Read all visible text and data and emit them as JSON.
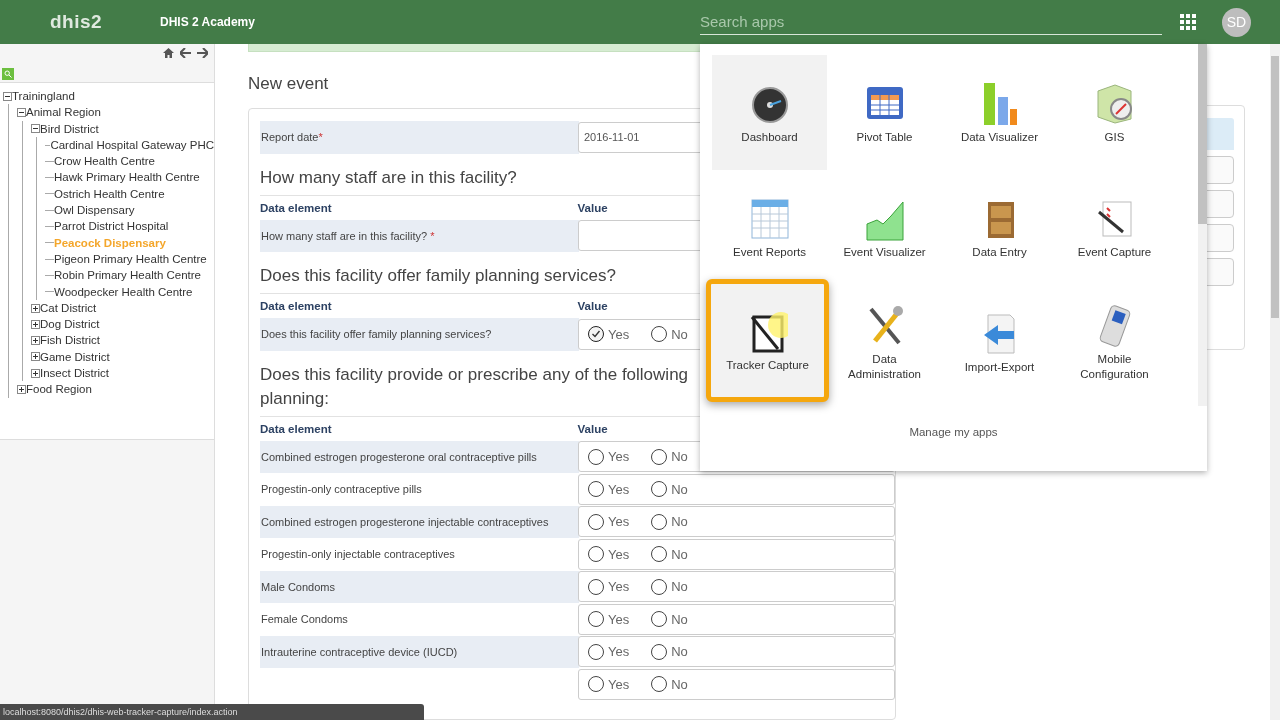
{
  "header": {
    "logo": "dhis2",
    "title": "DHIS 2 Academy",
    "search": {
      "placeholder": "Search apps"
    },
    "avatar": "SD"
  },
  "sidebar": {
    "tree": [
      {
        "label": "Trainingland",
        "expanded": true,
        "selected": false,
        "children": [
          {
            "label": "Animal Region",
            "expanded": true,
            "selected": false,
            "children": [
              {
                "label": "Bird District",
                "expanded": true,
                "selected": false,
                "children": [
                  {
                    "label": "Cardinal Hospital Gateway PHC",
                    "selected": false
                  },
                  {
                    "label": "Crow Health Centre",
                    "selected": false
                  },
                  {
                    "label": "Hawk Primary Health Centre",
                    "selected": false
                  },
                  {
                    "label": "Ostrich Health Centre",
                    "selected": false
                  },
                  {
                    "label": "Owl Dispensary",
                    "selected": false
                  },
                  {
                    "label": "Parrot District Hospital",
                    "selected": false
                  },
                  {
                    "label": "Peacock Dispensary",
                    "selected": true
                  },
                  {
                    "label": "Pigeon Primary Health Centre",
                    "selected": false
                  },
                  {
                    "label": "Robin Primary Health Centre",
                    "selected": false
                  },
                  {
                    "label": "Woodpecker Health Centre",
                    "selected": false
                  }
                ]
              },
              {
                "label": "Cat District",
                "expanded": false,
                "selected": false
              },
              {
                "label": "Dog District",
                "expanded": false,
                "selected": false
              },
              {
                "label": "Fish District",
                "expanded": false,
                "selected": false
              },
              {
                "label": "Game District",
                "expanded": false,
                "selected": false
              },
              {
                "label": "Insect District",
                "expanded": false,
                "selected": false
              }
            ]
          },
          {
            "label": "Food Region",
            "expanded": false,
            "selected": false
          }
        ]
      }
    ]
  },
  "main": {
    "title": "New event",
    "report_date": {
      "label": "Report date",
      "required_mark": "*",
      "value": "2016-11-01"
    },
    "sections": [
      {
        "title_lines": [
          "How many staff are in this facility?"
        ],
        "columns": [
          "Data element",
          "Value"
        ],
        "rows": [
          {
            "kind": "number",
            "label": "How many staff are in this facility?",
            "required_mark": "*"
          }
        ]
      },
      {
        "title_lines": [
          "Does this facility offer family planning services?"
        ],
        "columns": [
          "Data element",
          "Value"
        ],
        "rows": [
          {
            "kind": "yes_no",
            "label": "Does this facility offer family planning services?",
            "options": [
              {
                "label": "Yes",
                "selected": true
              },
              {
                "label": "No",
                "selected": false
              }
            ]
          }
        ]
      },
      {
        "title_lines": [
          "Does this facility provide or prescribe any of the following",
          "planning:"
        ],
        "columns": [
          "Data element",
          "Value"
        ],
        "rows": [
          {
            "kind": "yes_no",
            "label": "Combined estrogen progesterone oral contraceptive pills",
            "options": [
              {
                "label": "Yes",
                "selected": false
              },
              {
                "label": "No",
                "selected": false
              }
            ]
          },
          {
            "kind": "yes_no",
            "label": "Progestin-only contraceptive pills",
            "options": [
              {
                "label": "Yes",
                "selected": false
              },
              {
                "label": "No",
                "selected": false
              }
            ]
          },
          {
            "kind": "yes_no",
            "label": "Combined estrogen progesterone injectable contraceptives",
            "options": [
              {
                "label": "Yes",
                "selected": false
              },
              {
                "label": "No",
                "selected": false
              }
            ]
          },
          {
            "kind": "yes_no",
            "label": "Progestin-only injectable contraceptives",
            "options": [
              {
                "label": "Yes",
                "selected": false
              },
              {
                "label": "No",
                "selected": false
              }
            ]
          },
          {
            "kind": "yes_no",
            "label": "Male Condoms",
            "options": [
              {
                "label": "Yes",
                "selected": false
              },
              {
                "label": "No",
                "selected": false
              }
            ]
          },
          {
            "kind": "yes_no",
            "label": "Female Condoms",
            "options": [
              {
                "label": "Yes",
                "selected": false
              },
              {
                "label": "No",
                "selected": false
              }
            ]
          },
          {
            "kind": "yes_no",
            "label": "Intrauterine contraceptive device (IUCD)",
            "options": [
              {
                "label": "Yes",
                "selected": false
              },
              {
                "label": "No",
                "selected": false
              }
            ]
          },
          {
            "kind": "yes_no",
            "options": [
              {
                "label": "Yes",
                "selected": false
              },
              {
                "label": "No",
                "selected": false
              }
            ]
          }
        ]
      }
    ]
  },
  "app_menu": {
    "apps": [
      {
        "label": "Dashboard",
        "hovered": true,
        "selected": false
      },
      {
        "label": "Pivot Table",
        "hovered": false,
        "selected": false
      },
      {
        "label": "Data Visualizer",
        "hovered": false,
        "selected": false
      },
      {
        "label": "GIS",
        "hovered": false,
        "selected": false
      },
      {
        "label": "Event Reports",
        "hovered": false,
        "selected": false
      },
      {
        "label": "Event Visualizer",
        "hovered": false,
        "selected": false
      },
      {
        "label": "Data Entry",
        "hovered": false,
        "selected": false
      },
      {
        "label": "Event Capture",
        "hovered": false,
        "selected": false
      },
      {
        "label": "Tracker Capture",
        "hovered": true,
        "selected": true
      },
      {
        "label": "Data Administration",
        "hovered": false,
        "selected": false
      },
      {
        "label": "Import-Export",
        "hovered": false,
        "selected": false
      },
      {
        "label": "Mobile Configuration",
        "hovered": false,
        "selected": false
      }
    ],
    "footer_link": "Manage my apps"
  },
  "status_url": "localhost:8080/dhis2/dhis-web-tracker-capture/index.action"
}
